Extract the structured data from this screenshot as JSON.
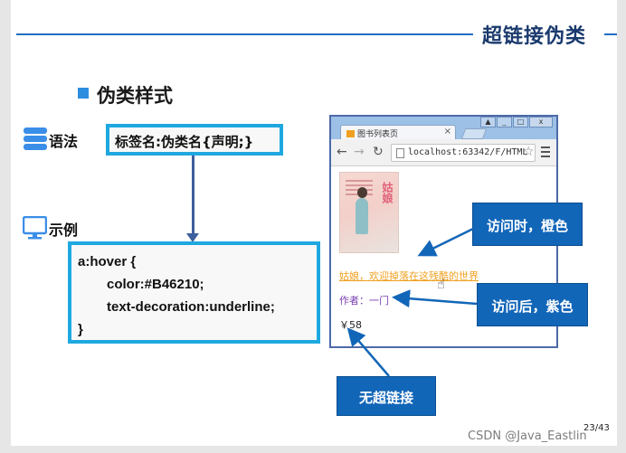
{
  "slide": {
    "title": "超链接伪类",
    "section_title": "伪类样式",
    "page_number": "23/43",
    "watermark": "CSDN @Java_Eastlin"
  },
  "syntax": {
    "label": "语法",
    "code": "标签名:伪类名{声明;}"
  },
  "example": {
    "label": "示例",
    "code_lines": [
      "a:hover {",
      "color:#B46210;",
      "text-decoration:underline;",
      "}"
    ]
  },
  "browser": {
    "tab_title": "图书列表页",
    "tab_close": "×",
    "address": "localhost:63342/F/HTML",
    "book_cover_title": "姑娘",
    "link_hover_text": "姑娘，欢迎掉落在这残酷的世界",
    "link_visited_text": "作者：一门",
    "price_text": "￥58"
  },
  "callouts": {
    "hover": "访问时，橙色",
    "visited": "访问后，紫色",
    "no_link": "无超链接"
  },
  "colors": {
    "accent_blue": "#1266b8",
    "box_border": "#1fa8e0",
    "hover_orange": "#f0a020",
    "visited_purple": "#7a3fb0"
  }
}
